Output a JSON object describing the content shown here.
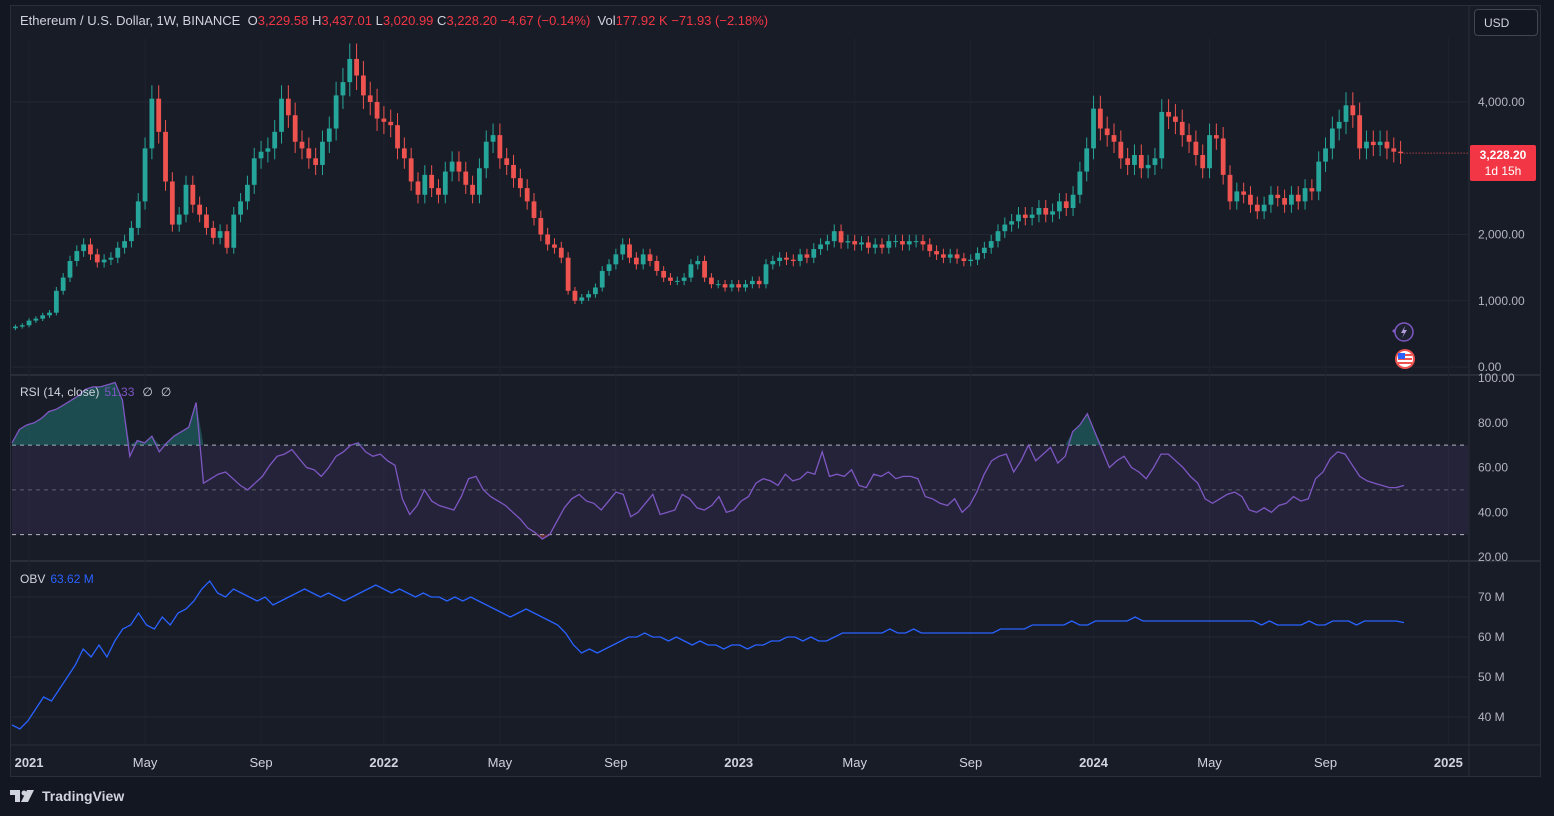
{
  "header": {
    "symbol": "Ethereum / U.S. Dollar, 1W, BINANCE",
    "o_label": "O",
    "o_value": "3,229.58",
    "h_label": "H",
    "h_value": "3,437.01",
    "l_label": "L",
    "l_value": "3,020.99",
    "c_label": "C",
    "c_value": "3,228.20",
    "change": "−4.67 (−0.14%)",
    "vol_label": "Vol",
    "vol_value": "177.92 K",
    "vol_change": "−71.93 (−2.18%)"
  },
  "currency_button": "USD",
  "price_tag": {
    "price": "3,228.20",
    "countdown": "1d 15h"
  },
  "rsi_label": {
    "name": "RSI (14, close)",
    "value": "51.33",
    "extra1": "∅",
    "extra2": "∅"
  },
  "obv_label": {
    "name": "OBV",
    "value": "63.62 M"
  },
  "brand": "TradingView",
  "colors": {
    "up": "#26a69a",
    "down": "#ef5350",
    "rsi": "#7e57c2",
    "obv": "#2962ff",
    "background": "#181c27"
  },
  "icons": [
    "lightning-icon",
    "us-flag-icon",
    "tradingview-logo-icon"
  ],
  "chart_data": [
    {
      "type": "candlestick",
      "title": "Ethereum / U.S. Dollar, 1W, BINANCE",
      "ylim": [
        0,
        5000
      ],
      "y_ticks": [
        "4,000.00",
        "2,000.00",
        "1,000.00",
        "0.00"
      ],
      "y_tick_values": [
        4000,
        2000,
        1000,
        0
      ],
      "x_ticks": [
        "2021",
        "May",
        "Sep",
        "2022",
        "May",
        "Sep",
        "2023",
        "May",
        "Sep",
        "2024",
        "May",
        "Sep",
        "2025"
      ],
      "x_tick_weeks": [
        2,
        19,
        36,
        54,
        71,
        88,
        106,
        123,
        140,
        158,
        175,
        192,
        210
      ],
      "weekly_close": [
        610,
        630,
        700,
        730,
        780,
        820,
        1150,
        1350,
        1600,
        1750,
        1850,
        1700,
        1580,
        1620,
        1650,
        1800,
        1900,
        2100,
        2500,
        3300,
        4050,
        3550,
        2800,
        2150,
        2300,
        2750,
        2450,
        2300,
        2100,
        1950,
        2050,
        1800,
        2300,
        2500,
        2750,
        3150,
        3250,
        3300,
        3550,
        4050,
        3800,
        3400,
        3300,
        3150,
        3050,
        3400,
        3600,
        4100,
        4300,
        4650,
        4400,
        4100,
        4000,
        3750,
        3700,
        3650,
        3300,
        3150,
        2800,
        2600,
        2900,
        2700,
        2600,
        2950,
        3100,
        2950,
        2750,
        2600,
        3000,
        3400,
        3500,
        3150,
        3050,
        2850,
        2700,
        2500,
        2250,
        2000,
        1850,
        1800,
        1650,
        1150,
        1000,
        1050,
        1100,
        1200,
        1450,
        1550,
        1700,
        1850,
        1650,
        1550,
        1700,
        1600,
        1450,
        1350,
        1300,
        1300,
        1350,
        1550,
        1600,
        1350,
        1250,
        1250,
        1200,
        1250,
        1200,
        1250,
        1300,
        1250,
        1550,
        1600,
        1650,
        1620,
        1600,
        1700,
        1650,
        1780,
        1850,
        1900,
        2050,
        1880,
        1900,
        1850,
        1880,
        1800,
        1850,
        1800,
        1900,
        1900,
        1850,
        1900,
        1900,
        1850,
        1750,
        1700,
        1650,
        1700,
        1640,
        1600,
        1620,
        1720,
        1800,
        1900,
        2050,
        2150,
        2200,
        2300,
        2250,
        2300,
        2400,
        2300,
        2350,
        2500,
        2400,
        2600,
        2950,
        3300,
        3900,
        3600,
        3500,
        3400,
        3150,
        3050,
        3200,
        3000,
        3050,
        3150,
        3850,
        3780,
        3700,
        3500,
        3400,
        3200,
        3000,
        3500,
        3450,
        2900,
        2500,
        2650,
        2600,
        2450,
        2350,
        2450,
        2600,
        2550,
        2450,
        2600,
        2500,
        2700,
        2650,
        3100,
        3300,
        3600,
        3700,
        3950,
        3800,
        3300,
        3400,
        3350,
        3400,
        3300,
        3250,
        3228
      ]
    },
    {
      "type": "line",
      "title": "RSI (14, close)",
      "ylim": [
        20,
        100
      ],
      "y_ticks": [
        "100.00",
        "80.00",
        "60.00",
        "40.00",
        "20.00"
      ],
      "y_tick_values": [
        100,
        80,
        60,
        40,
        20
      ],
      "bands": [
        70,
        50,
        30
      ],
      "values": [
        71,
        77,
        79,
        80,
        82,
        85,
        86,
        88,
        90,
        92,
        95,
        96,
        96,
        97,
        98,
        90,
        65,
        72,
        71,
        74,
        67,
        71,
        74,
        76,
        78,
        89,
        53,
        55,
        57,
        58,
        55,
        52,
        50,
        53,
        56,
        61,
        65,
        66,
        68,
        64,
        60,
        59,
        56,
        60,
        65,
        67,
        70,
        71,
        67,
        65,
        66,
        63,
        61,
        46,
        39,
        43,
        50,
        45,
        43,
        42,
        41,
        47,
        55,
        56,
        50,
        47,
        45,
        43,
        40,
        37,
        33,
        31,
        28,
        30,
        36,
        42,
        46,
        48,
        45,
        44,
        41,
        45,
        49,
        48,
        38,
        40,
        44,
        48,
        39,
        40,
        41,
        48,
        46,
        42,
        41,
        43,
        47,
        40,
        41,
        45,
        47,
        53,
        55,
        54,
        52,
        57,
        54,
        55,
        58,
        57,
        67,
        56,
        57,
        56,
        59,
        52,
        51,
        57,
        56,
        58,
        55,
        56,
        56,
        55,
        47,
        46,
        44,
        43,
        46,
        40,
        43,
        49,
        57,
        63,
        65,
        66,
        58,
        63,
        70,
        63,
        66,
        69,
        62,
        65,
        76,
        79,
        84,
        76,
        68,
        60,
        63,
        65,
        60,
        58,
        55,
        60,
        66,
        66,
        63,
        60,
        56,
        53,
        46,
        44,
        46,
        48,
        49,
        47,
        41,
        40,
        42,
        40,
        43,
        44,
        47,
        45,
        46,
        55,
        58,
        64,
        67,
        66,
        61,
        56,
        54,
        53,
        52,
        51,
        51,
        52
      ]
    },
    {
      "type": "line",
      "title": "OBV",
      "ylim": [
        34,
        76
      ],
      "y_ticks": [
        "70 M",
        "60 M",
        "50 M",
        "40 M"
      ],
      "y_tick_values": [
        70,
        60,
        50,
        40
      ],
      "values": [
        38,
        37,
        39,
        42,
        45,
        44,
        47,
        50,
        53,
        57,
        55,
        58,
        55,
        59,
        62,
        63,
        66,
        63,
        62,
        65,
        63,
        66,
        67,
        69,
        72,
        74,
        71,
        70,
        72,
        71,
        70,
        69,
        70,
        68,
        69,
        70,
        71,
        72,
        71,
        70,
        71,
        70,
        69,
        70,
        71,
        72,
        73,
        72,
        71,
        72,
        71,
        70,
        71,
        70,
        70,
        69,
        70,
        69,
        70,
        69,
        68,
        67,
        66,
        65,
        66,
        67,
        66,
        65,
        64,
        63,
        61,
        58,
        56,
        57,
        56,
        57,
        58,
        59,
        60,
        60,
        61,
        60,
        60,
        59,
        60,
        59,
        58,
        59,
        58,
        58,
        57,
        58,
        58,
        57,
        58,
        58,
        59,
        59,
        60,
        60,
        59,
        60,
        59,
        59,
        60,
        61,
        61,
        61,
        61,
        61,
        61,
        62,
        61,
        61,
        62,
        61,
        61,
        61,
        61,
        61,
        61,
        61,
        61,
        61,
        61,
        62,
        62,
        62,
        62,
        63,
        63,
        63,
        63,
        63,
        64,
        63,
        63,
        64,
        64,
        64,
        64,
        64,
        65,
        64,
        64,
        64,
        64,
        64,
        64,
        64,
        64,
        64,
        64,
        64,
        64,
        64,
        64,
        64,
        63,
        64,
        63,
        63,
        63,
        63,
        64,
        63,
        63,
        64,
        64,
        64,
        63,
        64,
        64,
        64,
        64,
        64,
        63.6
      ]
    }
  ]
}
